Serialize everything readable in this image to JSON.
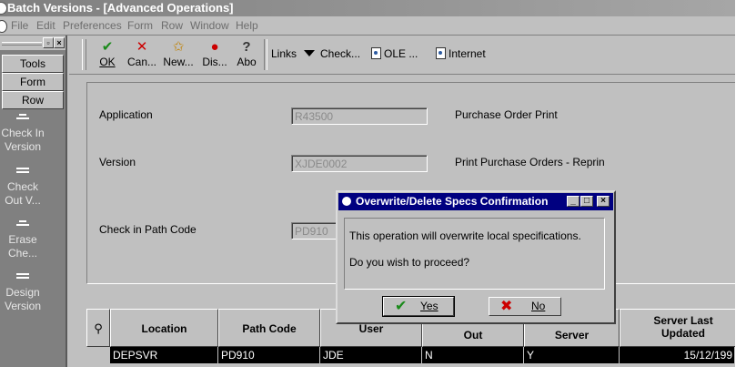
{
  "window": {
    "title": "Batch Versions - [Advanced Operations]"
  },
  "menubar": {
    "items": [
      "File",
      "Edit",
      "Preferences",
      "Form",
      "Row",
      "Window",
      "Help"
    ]
  },
  "leftpane": {
    "tabs": [
      "Tools",
      "Form",
      "Row"
    ],
    "items": [
      {
        "line1": "Check In",
        "line2": "Version"
      },
      {
        "line1": "Check",
        "line2": "Out V..."
      },
      {
        "line1": "Erase",
        "line2": "Che..."
      },
      {
        "line1": "Design",
        "line2": "Version"
      }
    ]
  },
  "toolbar": {
    "ok": "OK",
    "cancel": "Can...",
    "new": "New...",
    "display": "Dis...",
    "about": "Abo",
    "links": "Links",
    "check": "Check...",
    "ole": "OLE ...",
    "internet": "Internet"
  },
  "form": {
    "application_label": "Application",
    "application_value": "R43500",
    "application_desc": "Purchase Order Print",
    "version_label": "Version",
    "version_value": "XJDE0002",
    "version_desc": "Print Purchase Orders - Reprin",
    "path_label": "Check in Path Code",
    "path_value": "PD910"
  },
  "grid": {
    "headers": [
      "Location",
      "Path Code",
      "User",
      "Out",
      "Server",
      "Server Last Updated"
    ],
    "row": [
      "DEPSVR",
      "PD910",
      "JDE",
      "N",
      "Y",
      "15/12/199"
    ]
  },
  "dialog": {
    "title": "Overwrite/Delete Specs Confirmation",
    "line1": "This operation will overwrite local specifications.",
    "line2": "Do you wish to proceed?",
    "yes": "Yes",
    "no": "No"
  }
}
